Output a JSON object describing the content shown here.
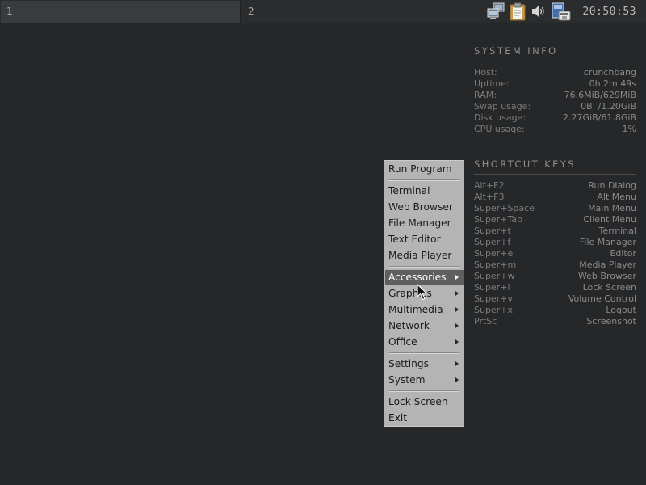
{
  "panel": {
    "desktops": [
      "1",
      "2"
    ],
    "tray_icons": [
      "network-icon",
      "clipboard-icon",
      "volume-icon",
      "update-manager-icon"
    ],
    "clock": "20:50:53"
  },
  "system_info": {
    "heading": "SYSTEM INFO",
    "rows": [
      {
        "label": "Host:",
        "value": "crunchbang"
      },
      {
        "label": "Uptime:",
        "value": "0h 2m 49s"
      },
      {
        "label": "RAM:",
        "value": "76.6MiB/629MiB"
      },
      {
        "label": "Swap usage:",
        "value": "0B  /1.20GiB"
      },
      {
        "label": "Disk usage:",
        "value": "2.27GiB/61.8GiB"
      },
      {
        "label": "CPU usage:",
        "value": "1%"
      }
    ]
  },
  "shortcut_keys": {
    "heading": "SHORTCUT KEYS",
    "rows": [
      {
        "key": "Alt+F2",
        "action": "Run Dialog"
      },
      {
        "key": "Alt+F3",
        "action": "Alt Menu"
      },
      {
        "key": "Super+Space",
        "action": "Main Menu"
      },
      {
        "key": "Super+Tab",
        "action": "Client Menu"
      },
      {
        "key": "Super+t",
        "action": "Terminal"
      },
      {
        "key": "Super+f",
        "action": "File Manager"
      },
      {
        "key": "Super+e",
        "action": "Editor"
      },
      {
        "key": "Super+m",
        "action": "Media Player"
      },
      {
        "key": "Super+w",
        "action": "Web Browser"
      },
      {
        "key": "Super+l",
        "action": "Lock Screen"
      },
      {
        "key": "Super+v",
        "action": "Volume Control"
      },
      {
        "key": "Super+x",
        "action": "Logout"
      },
      {
        "key": "PrtSc",
        "action": "Screenshot"
      }
    ]
  },
  "menu": {
    "items": [
      {
        "label": "Run Program"
      },
      {
        "label": "Terminal"
      },
      {
        "label": "Web Browser"
      },
      {
        "label": "File Manager"
      },
      {
        "label": "Text Editor"
      },
      {
        "label": "Media Player"
      },
      {
        "label": "Accessories",
        "submenu": true,
        "highlighted": true
      },
      {
        "label": "Graphics",
        "submenu": true
      },
      {
        "label": "Multimedia",
        "submenu": true
      },
      {
        "label": "Network",
        "submenu": true
      },
      {
        "label": "Office",
        "submenu": true
      },
      {
        "label": "Settings",
        "submenu": true
      },
      {
        "label": "System",
        "submenu": true
      },
      {
        "label": "Lock Screen"
      },
      {
        "label": "Exit"
      }
    ]
  },
  "colors": {
    "desktop_bg": "#262729",
    "panel_bg": "#2b2c2e",
    "menu_bg": "#b4b4b4",
    "menu_highlight": "#5f5f5f"
  }
}
